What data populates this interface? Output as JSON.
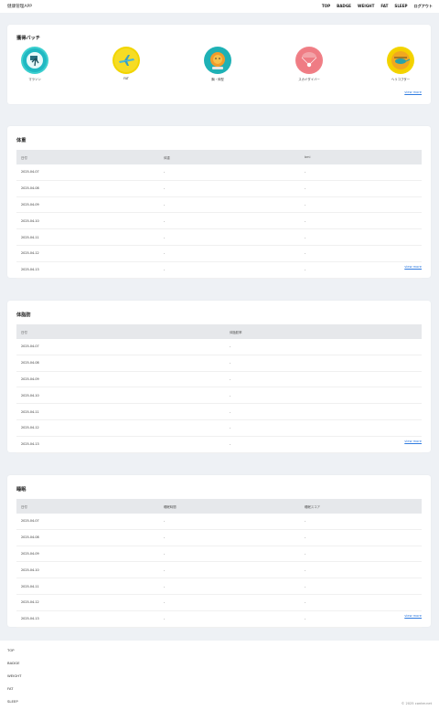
{
  "header": {
    "title": "健康管理APP",
    "nav": [
      "TOP",
      "BADGE",
      "WEIGHT",
      "FAT",
      "SLEEP",
      "ログアウト"
    ]
  },
  "badges": {
    "title": "獲得バッチ",
    "items": [
      {
        "label": "マラソン",
        "icon": "marathon-icon",
        "color": "#3ccfcf"
      },
      {
        "label": "FAT",
        "icon": "airplane-icon",
        "color": "#f2d500"
      },
      {
        "label": "胸・体型",
        "icon": "lion-icon",
        "color": "#1eb1b5"
      },
      {
        "label": "スカイダイバー",
        "icon": "skydiver-icon",
        "color": "#f07f86"
      },
      {
        "label": "ヘリコプター",
        "icon": "helicopter-icon",
        "color": "#f2d500"
      }
    ],
    "view_more": "view more"
  },
  "weight": {
    "title": "体重",
    "headers": [
      "日付",
      "体重",
      "bmi"
    ],
    "rows": [
      [
        "2025-04-07",
        "-",
        "-"
      ],
      [
        "2025-04-08",
        "-",
        "-"
      ],
      [
        "2025-04-09",
        "-",
        "-"
      ],
      [
        "2025-04-10",
        "-",
        "-"
      ],
      [
        "2025-04-11",
        "-",
        "-"
      ],
      [
        "2025-04-12",
        "-",
        "-"
      ],
      [
        "2025-04-13",
        "-",
        "-"
      ]
    ],
    "view_more": "view more"
  },
  "fat": {
    "title": "体脂肪",
    "headers": [
      "日付",
      "体脂肪率"
    ],
    "rows": [
      [
        "2025-04-07",
        "-"
      ],
      [
        "2025-04-08",
        "-"
      ],
      [
        "2025-04-09",
        "-"
      ],
      [
        "2025-04-10",
        "-"
      ],
      [
        "2025-04-11",
        "-"
      ],
      [
        "2025-04-12",
        "-"
      ],
      [
        "2025-04-13",
        "-"
      ]
    ],
    "view_more": "view more"
  },
  "sleep": {
    "title": "睡眠",
    "headers": [
      "日付",
      "睡眠時間",
      "睡眠スコア"
    ],
    "rows": [
      [
        "2025-04-07",
        "-",
        "-"
      ],
      [
        "2025-04-08",
        "-",
        "-"
      ],
      [
        "2025-04-09",
        "-",
        "-"
      ],
      [
        "2025-04-10",
        "-",
        "-"
      ],
      [
        "2025-04-11",
        "-",
        "-"
      ],
      [
        "2025-04-12",
        "-",
        "-"
      ],
      [
        "2025-04-13",
        "-",
        "-"
      ]
    ],
    "view_more": "view more"
  },
  "footer": {
    "links": [
      "TOP",
      "BADGE",
      "WEIGHT",
      "FAT",
      "SLEEP"
    ],
    "copyright": "© 2025 conter.net"
  }
}
